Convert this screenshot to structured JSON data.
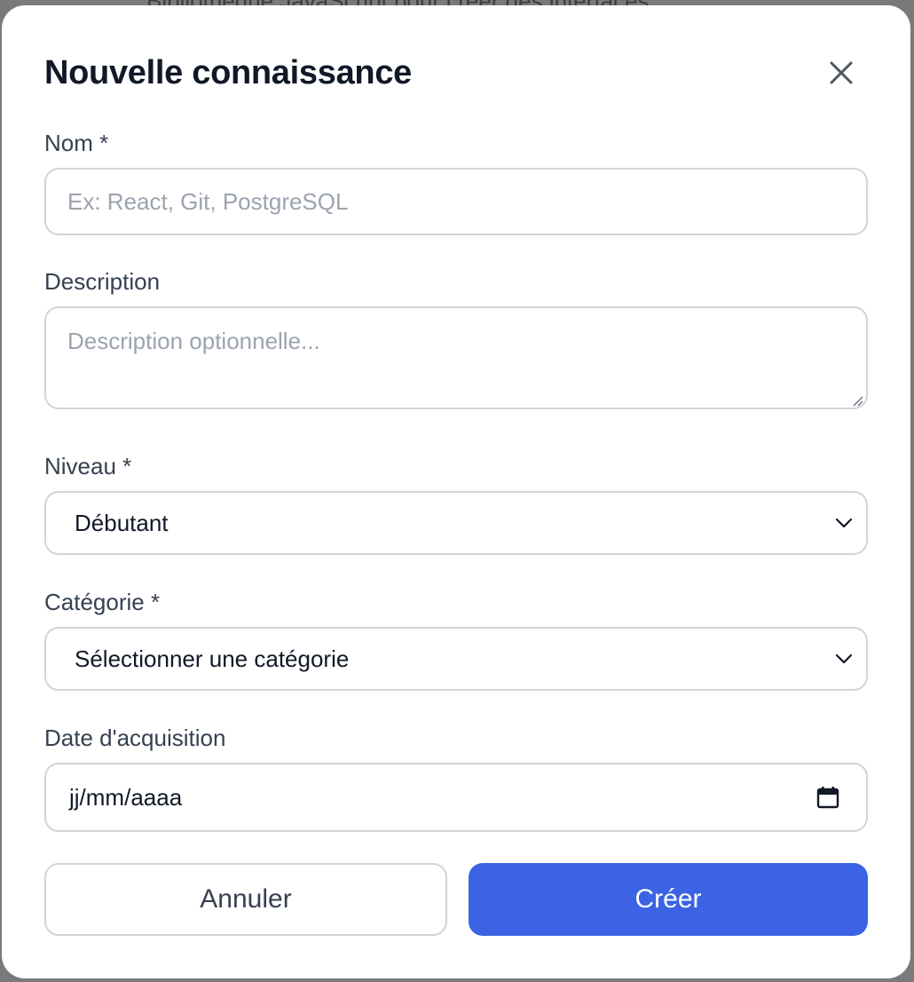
{
  "background": {
    "partial_text": "Bibliothèque JavaScript pour créer des interfaces"
  },
  "modal": {
    "title": "Nouvelle connaissance",
    "close_icon": "close-icon"
  },
  "form": {
    "name": {
      "label": "Nom *",
      "placeholder": "Ex: React, Git, PostgreSQL",
      "value": ""
    },
    "description": {
      "label": "Description",
      "placeholder": "Description optionnelle...",
      "value": ""
    },
    "level": {
      "label": "Niveau *",
      "selected": "Débutant",
      "icon": "chevron-down-icon"
    },
    "category": {
      "label": "Catégorie *",
      "selected": "Sélectionner une catégorie",
      "icon": "chevron-down-icon"
    },
    "acquisition_date": {
      "label": "Date d'acquisition",
      "placeholder": "jj/mm/aaaa",
      "icon": "calendar-icon"
    }
  },
  "actions": {
    "cancel_label": "Annuler",
    "create_label": "Créer"
  },
  "colors": {
    "primary": "#3b63e3",
    "title": "#111827",
    "label": "#374151",
    "border": "#d1d5db",
    "placeholder": "#9ca3af"
  }
}
